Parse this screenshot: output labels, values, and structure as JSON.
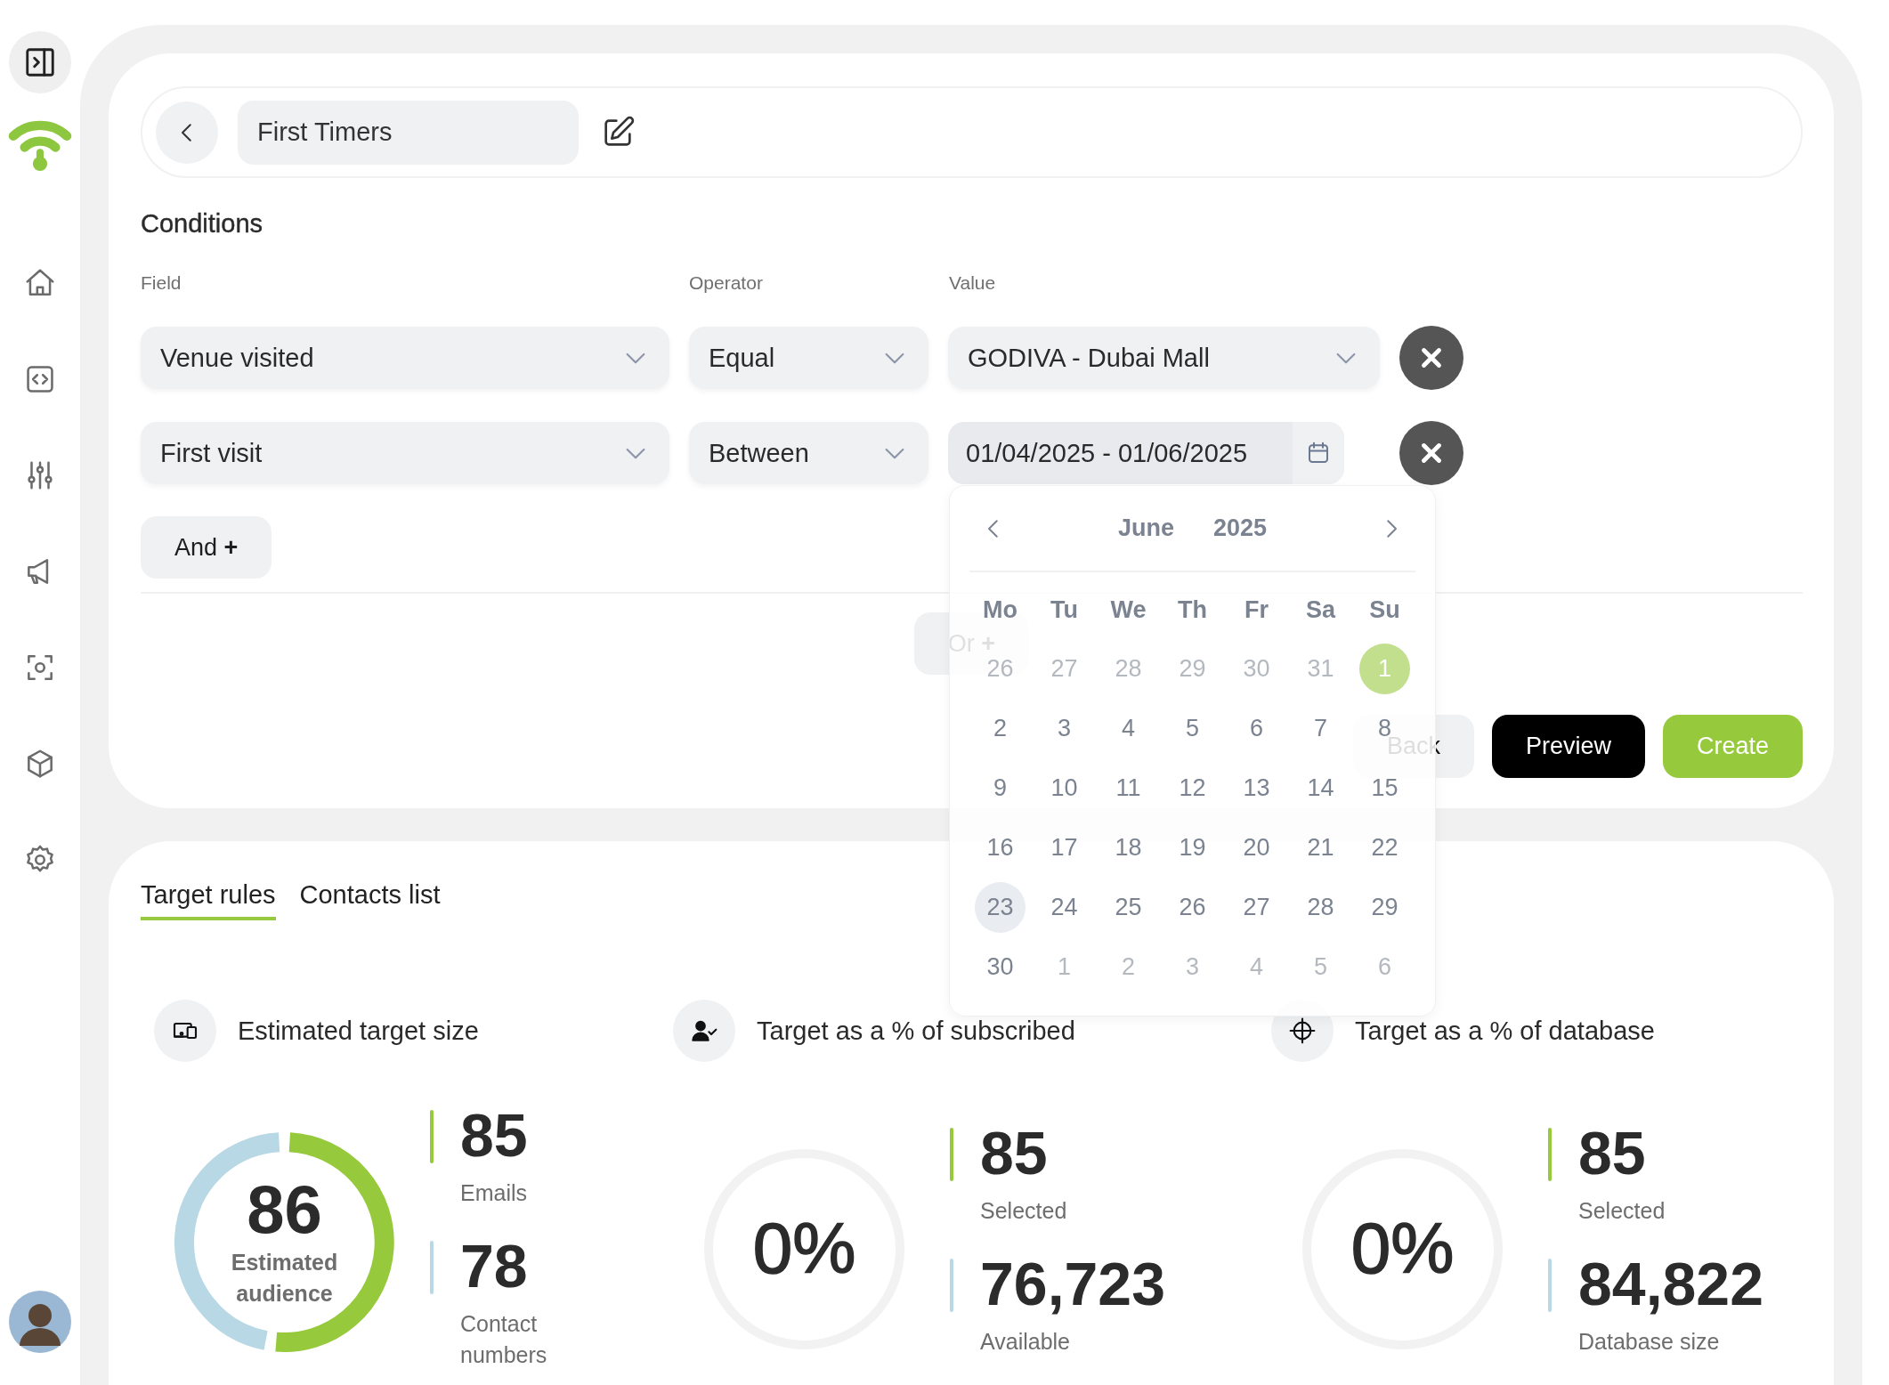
{
  "header": {
    "title": "First Timers"
  },
  "conditions": {
    "title": "Conditions",
    "columns": [
      "Field",
      "Operator",
      "Value"
    ],
    "rows": [
      {
        "kind": "select",
        "field": "Venue visited",
        "operator": "Equal",
        "value": "GODIVA - Dubai Mall"
      },
      {
        "kind": "date",
        "field": "First visit",
        "operator": "Between",
        "value": "01/04/2025 - 01/06/2025"
      }
    ],
    "and_button": "And **+**",
    "or_button": "Or **+**"
  },
  "actions": [
    {
      "kind": "secondary",
      "label": "Back"
    },
    {
      "kind": "dark",
      "label": "Preview"
    },
    {
      "kind": "primary",
      "label": "Create"
    }
  ],
  "calendar": {
    "month": "June",
    "year": "2025",
    "weekdays": [
      "Mo",
      "Tu",
      "We",
      "Th",
      "Fr",
      "Sa",
      "Su"
    ],
    "weeks": [
      [
        {
          "day": "26",
          "outside": true,
          "selected": false,
          "today": false
        },
        {
          "day": "27",
          "outside": true,
          "selected": false,
          "today": false
        },
        {
          "day": "28",
          "outside": true,
          "selected": false,
          "today": false
        },
        {
          "day": "29",
          "outside": true,
          "selected": false,
          "today": false
        },
        {
          "day": "30",
          "outside": true,
          "selected": false,
          "today": false
        },
        {
          "day": "31",
          "outside": true,
          "selected": false,
          "today": false
        },
        {
          "day": "1",
          "outside": false,
          "selected": true,
          "today": false
        }
      ],
      [
        {
          "day": "2",
          "outside": false,
          "selected": false,
          "today": false
        },
        {
          "day": "3",
          "outside": false,
          "selected": false,
          "today": false
        },
        {
          "day": "4",
          "outside": false,
          "selected": false,
          "today": false
        },
        {
          "day": "5",
          "outside": false,
          "selected": false,
          "today": false
        },
        {
          "day": "6",
          "outside": false,
          "selected": false,
          "today": false
        },
        {
          "day": "7",
          "outside": false,
          "selected": false,
          "today": false
        },
        {
          "day": "8",
          "outside": false,
          "selected": false,
          "today": false
        }
      ],
      [
        {
          "day": "9",
          "outside": false,
          "selected": false,
          "today": false
        },
        {
          "day": "10",
          "outside": false,
          "selected": false,
          "today": false
        },
        {
          "day": "11",
          "outside": false,
          "selected": false,
          "today": false
        },
        {
          "day": "12",
          "outside": false,
          "selected": false,
          "today": false
        },
        {
          "day": "13",
          "outside": false,
          "selected": false,
          "today": false
        },
        {
          "day": "14",
          "outside": false,
          "selected": false,
          "today": false
        },
        {
          "day": "15",
          "outside": false,
          "selected": false,
          "today": false
        }
      ],
      [
        {
          "day": "16",
          "outside": false,
          "selected": false,
          "today": false
        },
        {
          "day": "17",
          "outside": false,
          "selected": false,
          "today": false
        },
        {
          "day": "18",
          "outside": false,
          "selected": false,
          "today": false
        },
        {
          "day": "19",
          "outside": false,
          "selected": false,
          "today": false
        },
        {
          "day": "20",
          "outside": false,
          "selected": false,
          "today": false
        },
        {
          "day": "21",
          "outside": false,
          "selected": false,
          "today": false
        },
        {
          "day": "22",
          "outside": false,
          "selected": false,
          "today": false
        }
      ],
      [
        {
          "day": "23",
          "outside": false,
          "selected": false,
          "today": true
        },
        {
          "day": "24",
          "outside": false,
          "selected": false,
          "today": false
        },
        {
          "day": "25",
          "outside": false,
          "selected": false,
          "today": false
        },
        {
          "day": "26",
          "outside": false,
          "selected": false,
          "today": false
        },
        {
          "day": "27",
          "outside": false,
          "selected": false,
          "today": false
        },
        {
          "day": "28",
          "outside": false,
          "selected": false,
          "today": false
        },
        {
          "day": "29",
          "outside": false,
          "selected": false,
          "today": false
        }
      ],
      [
        {
          "day": "30",
          "outside": false,
          "selected": false,
          "today": false
        },
        {
          "day": "1",
          "outside": true,
          "selected": false,
          "today": false
        },
        {
          "day": "2",
          "outside": true,
          "selected": false,
          "today": false
        },
        {
          "day": "3",
          "outside": true,
          "selected": false,
          "today": false
        },
        {
          "day": "4",
          "outside": true,
          "selected": false,
          "today": false
        },
        {
          "day": "5",
          "outside": true,
          "selected": false,
          "today": false
        },
        {
          "day": "6",
          "outside": true,
          "selected": false,
          "today": false
        }
      ]
    ]
  },
  "tabs": [
    {
      "label": "Target rules",
      "selected": true
    },
    {
      "label": "Contacts list",
      "selected": false
    }
  ],
  "stats": [
    {
      "kind": "donut",
      "title": "Estimated target size",
      "value": "86",
      "caption": "Estimated audience",
      "metrics": [
        {
          "value": "85",
          "label": "Emails",
          "color": "#97c93d"
        },
        {
          "value": "78",
          "label": "Contact numbers",
          "color": "#b7d8e4"
        }
      ]
    },
    {
      "kind": "ring",
      "title": "Target as a % of subscribed",
      "value": "0%",
      "metrics": [
        {
          "value": "85",
          "label": "Selected",
          "color": "#97c93d"
        },
        {
          "value": "76,723",
          "label": "Available",
          "color": "#b7d8e4"
        }
      ]
    },
    {
      "kind": "ring",
      "title": "Target as a % of database",
      "value": "0%",
      "metrics": [
        {
          "value": "85",
          "label": "Selected",
          "color": "#97c93d"
        },
        {
          "value": "84,822",
          "label": "Database size",
          "color": "#b7d8e4"
        }
      ]
    }
  ]
}
